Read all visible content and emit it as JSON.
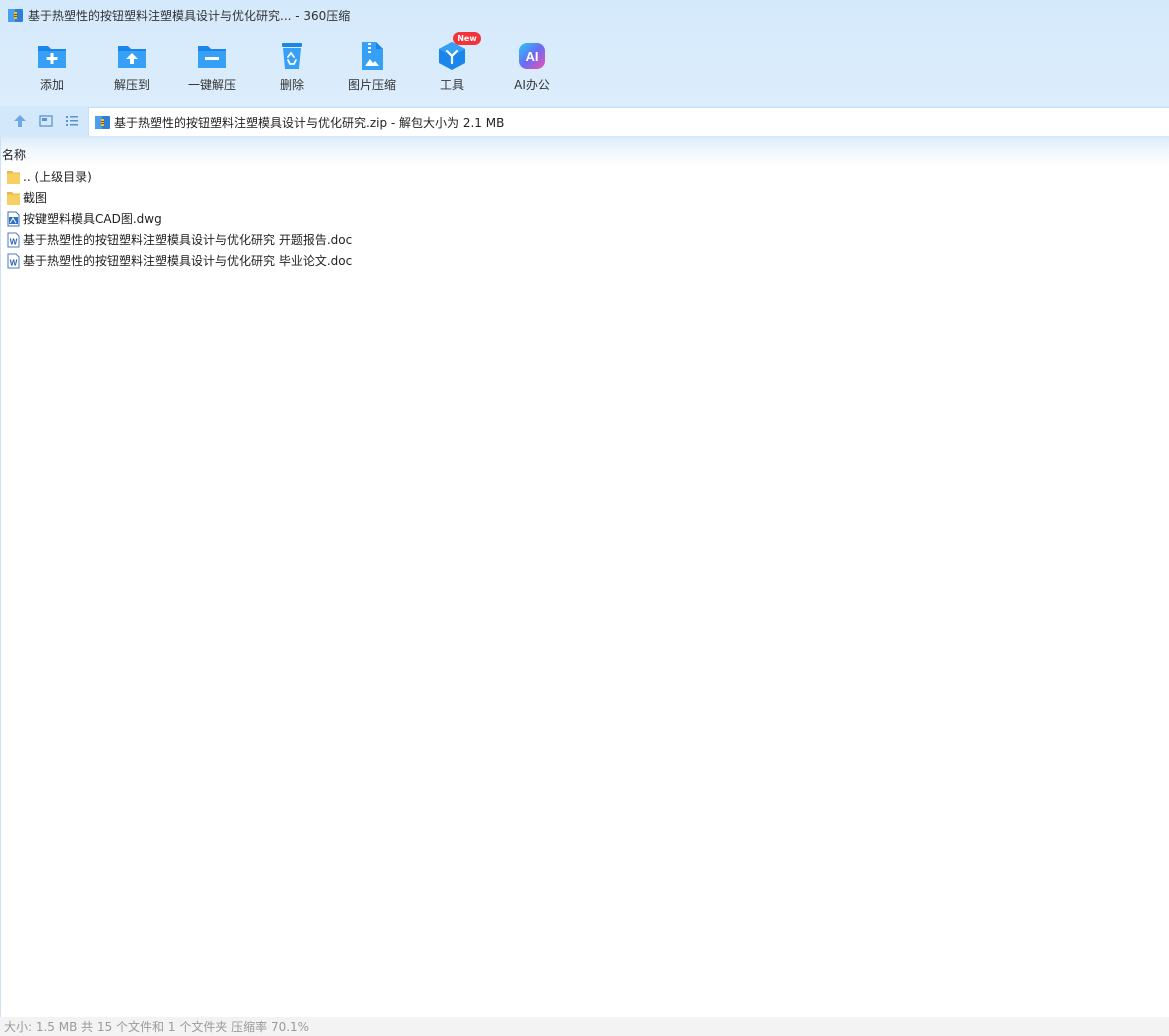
{
  "window": {
    "title": "基于热塑性的按钮塑料注塑模具设计与优化研究... - 360压缩",
    "icon": "archive-icon"
  },
  "toolbar": {
    "items": [
      {
        "label": "添加",
        "icon": "folder-add-icon"
      },
      {
        "label": "解压到",
        "icon": "folder-extract-icon"
      },
      {
        "label": "一键解压",
        "icon": "folder-oneclick-extract-icon"
      },
      {
        "label": "删除",
        "icon": "recycle-bin-icon"
      },
      {
        "label": "图片压缩",
        "icon": "image-compress-icon"
      },
      {
        "label": "工具",
        "icon": "tools-cube-icon"
      },
      {
        "label": "AI办公",
        "icon": "ai-office-icon"
      }
    ],
    "new_badge": "New"
  },
  "address": {
    "text": "基于热塑性的按钮塑料注塑模具设计与优化研究.zip - 解包大小为 2.1 MB"
  },
  "list": {
    "column_name": "名称",
    "rows": [
      {
        "name": ".. (上级目录)",
        "type": "folder"
      },
      {
        "name": "截图",
        "type": "folder"
      },
      {
        "name": "按键塑料模具CAD图.dwg",
        "type": "dwg"
      },
      {
        "name": "基于热塑性的按钮塑料注塑模具设计与优化研究  开题报告.doc",
        "type": "word"
      },
      {
        "name": "基于热塑性的按钮塑料注塑模具设计与优化研究 毕业论文.doc",
        "type": "word"
      }
    ]
  },
  "status": {
    "text": "大小: 1.5 MB 共 15 个文件和 1 个文件夹 压缩率 70.1%"
  },
  "colors": {
    "accent": "#1e8ff0",
    "header_bg": "#d4e9fb",
    "badge": "#f2343a",
    "folder": "#f7cf62"
  }
}
